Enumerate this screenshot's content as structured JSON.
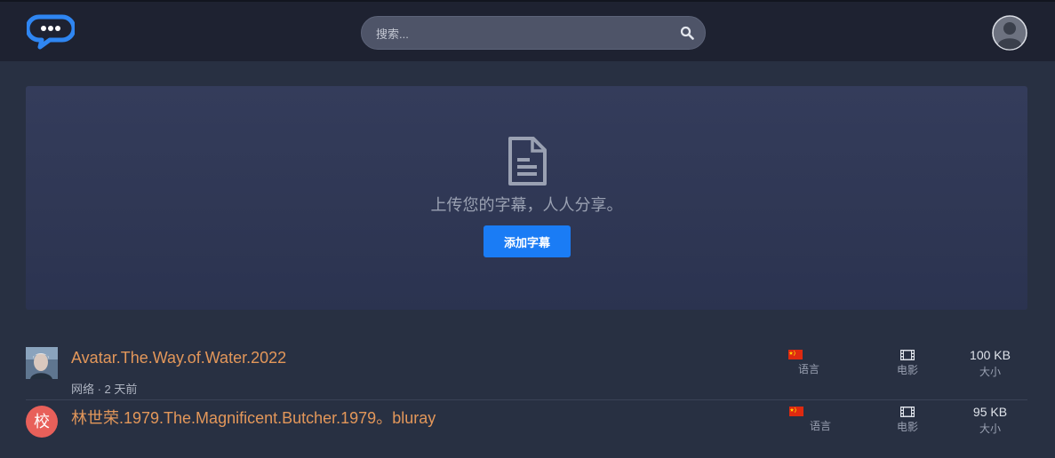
{
  "header": {
    "search_placeholder": "搜索..."
  },
  "hero": {
    "text": "上传您的字幕，人人分享。",
    "button": "添加字幕"
  },
  "subtitles": [
    {
      "title": "Avatar.The.Way.of.Water.2022",
      "meta": "网络 · 2 天前",
      "lang_label": "语言",
      "type_label": "电影",
      "size": "100 KB",
      "size_label": "大小"
    },
    {
      "thumb_char": "校",
      "title": "林世荣.1979.The.Magnificent.Butcher.1979。bluray",
      "lang_label": "语言",
      "type_label": "电影",
      "size": "95 KB",
      "size_label": "大小"
    }
  ],
  "colors": {
    "accent": "#1a7cf5",
    "title": "#e3975a",
    "background": "#283042",
    "header": "#1e2231"
  }
}
